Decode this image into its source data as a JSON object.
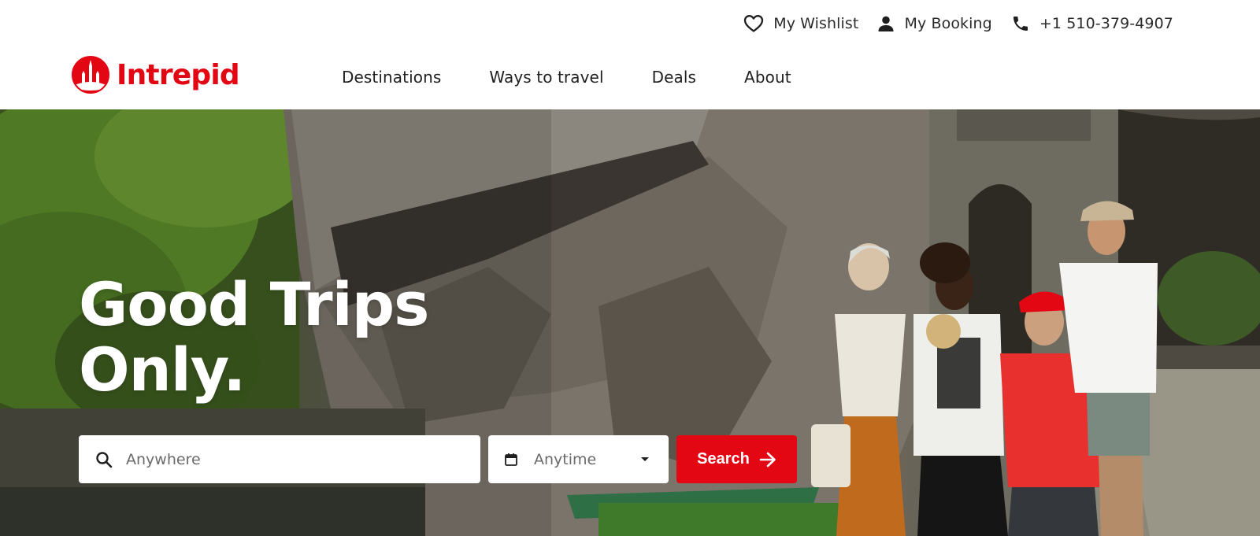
{
  "brand": {
    "name": "Intrepid",
    "color": "#e30613"
  },
  "utility_nav": {
    "wishlist_label": "My Wishlist",
    "booking_label": "My Booking",
    "phone_label": "+1 510-379-4907",
    "icons": [
      "heart-icon",
      "user-icon",
      "phone-icon"
    ]
  },
  "main_nav": {
    "items": [
      {
        "label": "Destinations"
      },
      {
        "label": "Ways to travel"
      },
      {
        "label": "Deals"
      },
      {
        "label": "About"
      }
    ]
  },
  "hero": {
    "headline_line1": "Good Trips",
    "headline_line2": "Only."
  },
  "search": {
    "where_placeholder": "Anywhere",
    "when_value": "Anytime",
    "button_label": "Search",
    "icons": [
      "search-icon",
      "calendar-icon",
      "caret-down-icon",
      "arrow-right-icon"
    ]
  }
}
